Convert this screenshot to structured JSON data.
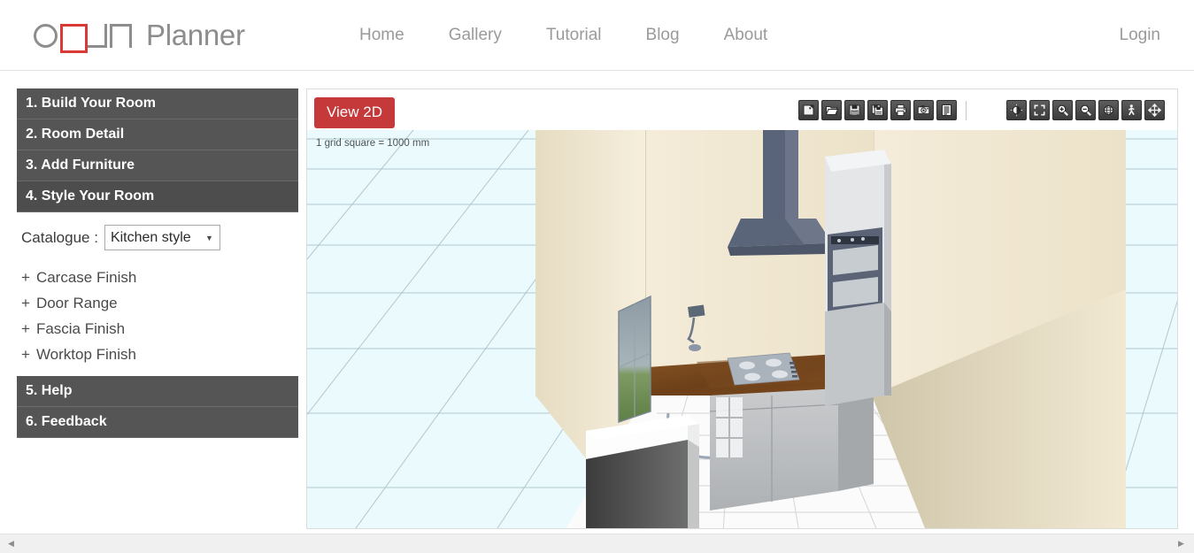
{
  "brand": {
    "logo_letters": [
      "O",
      "P",
      "U",
      "N"
    ],
    "logo_word": "Planner",
    "accent_color": "#d93a36",
    "logo_gray": "#8d8d8d"
  },
  "header": {
    "nav": [
      {
        "label": "Home",
        "name": "nav-home"
      },
      {
        "label": "Gallery",
        "name": "nav-gallery"
      },
      {
        "label": "Tutorial",
        "name": "nav-tutorial"
      },
      {
        "label": "Blog",
        "name": "nav-blog"
      },
      {
        "label": "About",
        "name": "nav-about"
      }
    ],
    "login_label": "Login"
  },
  "sidebar": {
    "steps": [
      {
        "label": "1. Build Your Room",
        "active": false
      },
      {
        "label": "2. Room Detail",
        "active": false
      },
      {
        "label": "3. Add Furniture",
        "active": false
      },
      {
        "label": "4. Style Your Room",
        "active": true
      }
    ],
    "panel": {
      "catalogue_label": "Catalogue :",
      "catalogue_value": "Kitchen style",
      "catalogue_options": [
        "Kitchen style"
      ],
      "finish_items": [
        {
          "prefix": "+",
          "label": "Carcase Finish"
        },
        {
          "prefix": "+",
          "label": "Door Range"
        },
        {
          "prefix": "+",
          "label": "Fascia Finish"
        },
        {
          "prefix": "+",
          "label": "Worktop Finish"
        }
      ]
    },
    "footer_steps": [
      {
        "label": "5. Help"
      },
      {
        "label": "6. Feedback"
      }
    ]
  },
  "viewport": {
    "view_toggle_label": "View 2D",
    "grid_note": "1 grid square = 1000 mm",
    "toolbar_left": [
      {
        "name": "new-design-icon",
        "title": "New"
      },
      {
        "name": "open-design-icon",
        "title": "Open"
      },
      {
        "name": "save-design-icon",
        "title": "Save"
      },
      {
        "name": "save-as-design-icon",
        "title": "Save As"
      },
      {
        "name": "print-icon",
        "title": "Print"
      },
      {
        "name": "snapshot-camera-icon",
        "title": "Snapshot"
      },
      {
        "name": "report-list-icon",
        "title": "Report"
      }
    ],
    "toolbar_right": [
      {
        "name": "lighting-icon",
        "title": "Lighting"
      },
      {
        "name": "fit-to-screen-icon",
        "title": "Fit to screen"
      },
      {
        "name": "zoom-in-icon",
        "title": "Zoom in"
      },
      {
        "name": "zoom-out-icon",
        "title": "Zoom out"
      },
      {
        "name": "orbit-globe-icon",
        "title": "Orbit"
      },
      {
        "name": "walkthrough-person-icon",
        "title": "Walkthrough"
      },
      {
        "name": "pan-move-icon",
        "title": "Pan"
      }
    ],
    "scene": {
      "description": "3D kitchen room perspective view",
      "wall_color": "#efe5cf",
      "floor_tile_color": "#fbfbfb",
      "worktop_color": "#6b3f1d",
      "cabinet_color": "#b9bbbd",
      "appliance_color": "#5b6476",
      "grid_background": "#eafafd",
      "grid_line_color": "#9fb7bd"
    }
  },
  "scrollbar": {
    "left_arrow": "◀",
    "right_arrow": "▶"
  }
}
